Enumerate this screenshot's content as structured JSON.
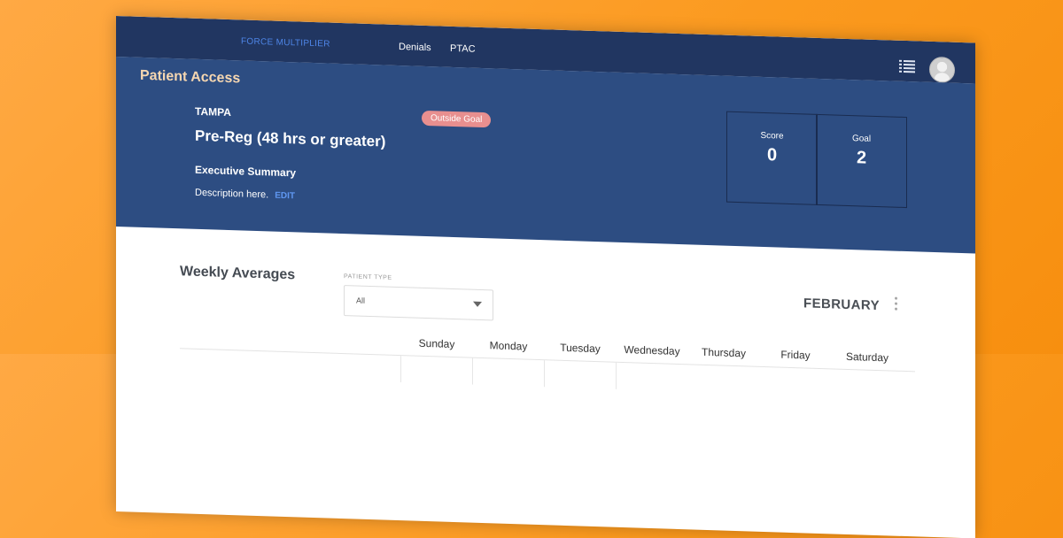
{
  "nav": {
    "brand": "FORCE MULTIPLIER",
    "links": [
      "Denials",
      "PTAC"
    ],
    "list_icon": "list-view-icon",
    "avatar_icon": "user-avatar"
  },
  "hero": {
    "section_title": "Patient Access",
    "location": "TAMPA",
    "status_badge": "Outside Goal",
    "metric_name": "Pre-Reg (48 hrs or greater)",
    "summary_title": "Executive Summary",
    "description": "Description here.",
    "edit_label": "EDIT",
    "score_label": "Score",
    "score_value": "0",
    "goal_label": "Goal",
    "goal_value": "2"
  },
  "weekly": {
    "title": "Weekly Averages",
    "patient_type_label": "PATIENT TYPE",
    "patient_type_value": "All",
    "month": "FEBRUARY",
    "days": [
      "Sunday",
      "Monday",
      "Tuesday",
      "Wednesday",
      "Thursday",
      "Friday",
      "Saturday"
    ]
  },
  "colors": {
    "background": "#fb9a1f",
    "nav": "#213661",
    "hero": "#2d4d82",
    "brand_accent": "#4e86e8",
    "section_title": "#f6d7b1",
    "badge": "#e88f8f"
  }
}
